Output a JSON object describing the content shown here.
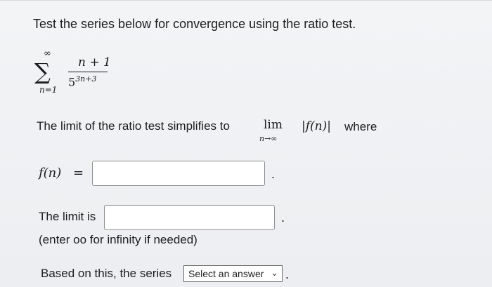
{
  "question": "Test the series below for convergence using the ratio test.",
  "series": {
    "sum_symbol": "∑",
    "upper": "∞",
    "lower": "n=1",
    "numerator": "n + 1",
    "denominator_base": "5",
    "denominator_exp": "3n+3"
  },
  "ratio": {
    "text": "The limit of the ratio test simplifies to",
    "lim_word": "lim",
    "lim_sub": "n→∞",
    "abs_f": "|f(n)|",
    "where": "where"
  },
  "f_input": {
    "label": "f(n)",
    "equals": "=",
    "value": "",
    "trailing_dot": "."
  },
  "limit_input": {
    "label": "The limit is",
    "value": "",
    "trailing_dot": ".",
    "hint": "(enter oo for infinity if needed)"
  },
  "conclusion": {
    "text": "Based on this, the series",
    "select_label": "Select an answer",
    "trailing_dot": "."
  }
}
